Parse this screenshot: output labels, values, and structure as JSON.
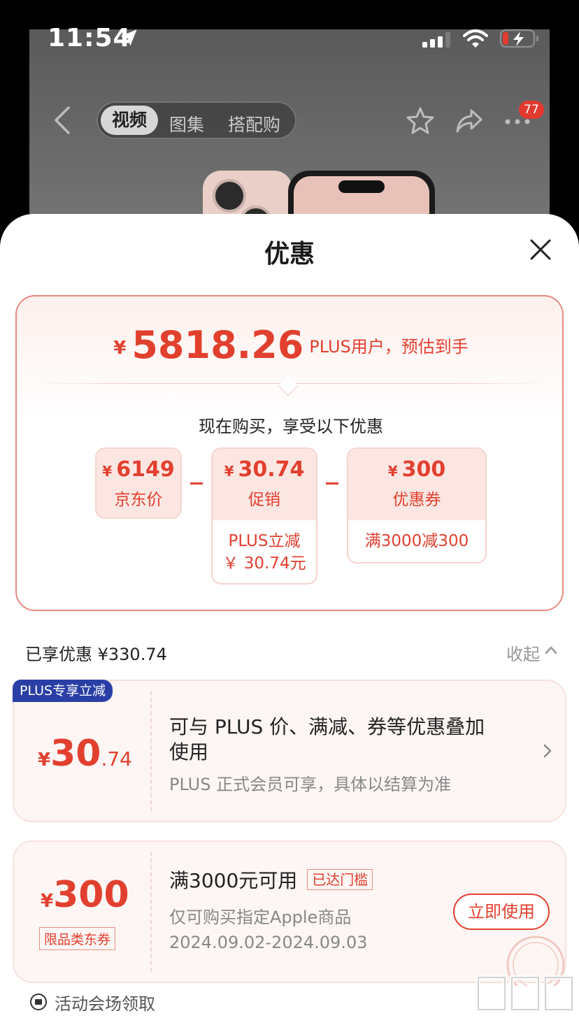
{
  "status_bar": {
    "time": "11:54"
  },
  "header": {
    "tabs": [
      {
        "label": "视频"
      },
      {
        "label": "图集"
      },
      {
        "label": "搭配购"
      }
    ],
    "notification_count": "77"
  },
  "sheet": {
    "title": "优惠",
    "estimate": {
      "currency": "¥",
      "amount": "5818.26",
      "note": "PLUS用户，预估到手"
    },
    "buy_now_text": "现在购买，享受以下优惠",
    "breakdown": [
      {
        "currency": "¥",
        "amount": "6149",
        "label": "京东价",
        "sub": ""
      },
      {
        "currency": "¥",
        "amount": "30.74",
        "label": "促销",
        "sub1": "PLUS立减",
        "sub2": "￥ 30.74元"
      },
      {
        "currency": "¥",
        "amount": "300",
        "label": "优惠券",
        "sub1": "满3000减300"
      }
    ],
    "enjoyed": "已享优惠 ¥330.74",
    "collapse_label": "收起",
    "coupons": [
      {
        "tag": "PLUS专享立减",
        "currency": "¥",
        "amount_int": "30",
        "amount_dec": ".74",
        "title_line1": "可与 PLUS 价、满减、券等优惠叠加",
        "title_line2": "使用",
        "subtitle": "PLUS 正式会员可享，具体以结算为准"
      },
      {
        "currency": "¥",
        "amount_int": "300",
        "category": "限品类东券",
        "title": "满3000元可用",
        "reached": "已达门槛",
        "scope": "仅可购买指定Apple商品",
        "validity": "2024.09.02-2024.09.03",
        "action": "立即使用"
      }
    ],
    "venue_text": "活动会场领取"
  },
  "colors": {
    "accent": "#e2402f",
    "plus_blue": "#2a3fa6"
  },
  "icons": [
    "location-arrow-icon",
    "signal-icon",
    "wifi-icon",
    "battery-icon",
    "back-icon",
    "star-icon",
    "share-icon",
    "more-icon",
    "close-icon",
    "chevron-up-icon",
    "chevron-right-icon",
    "venue-icon"
  ]
}
